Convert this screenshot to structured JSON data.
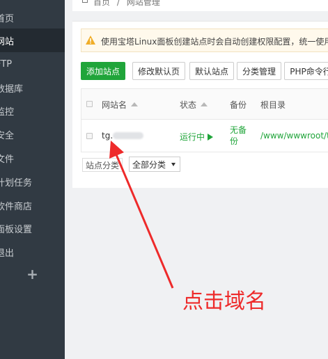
{
  "sidebar": {
    "items": [
      {
        "label": "首页",
        "active": false
      },
      {
        "label": "网站",
        "active": true
      },
      {
        "label": "FTP",
        "active": false
      },
      {
        "label": "数据库",
        "active": false
      },
      {
        "label": "监控",
        "active": false
      },
      {
        "label": "安全",
        "active": false
      },
      {
        "label": "文件",
        "active": false
      },
      {
        "label": "计划任务",
        "active": false
      },
      {
        "label": "软件商店",
        "active": false
      },
      {
        "label": "面板设置",
        "active": false
      },
      {
        "label": "退出",
        "active": false
      }
    ],
    "add_label": "+"
  },
  "breadcrumb": {
    "home": "首页",
    "sep": "/",
    "current": "网站管理"
  },
  "alert": {
    "text": "使用宝塔Linux面板创建站点时会自动创建权限配置，统一使用"
  },
  "toolbar": {
    "add_site": "添加站点",
    "edit_default_page": "修改默认页",
    "default_site": "默认站点",
    "category_manage": "分类管理",
    "php_cli": "PHP命令行"
  },
  "table": {
    "headers": {
      "name": "网站名",
      "status": "状态",
      "backup": "备份",
      "root": "根目录"
    },
    "rows": [
      {
        "name_prefix": "tg.",
        "status": "运行中",
        "backup_line1": "无备",
        "backup_line2": "份",
        "root": "/www/wwwroot/t"
      }
    ]
  },
  "filter": {
    "label": "站点分类",
    "selected": "全部分类"
  },
  "annotation": {
    "text": "点击域名"
  },
  "colors": {
    "accent": "#20a53a",
    "sidebar_bg": "#313a43",
    "annotation": "#ee2a2a"
  }
}
